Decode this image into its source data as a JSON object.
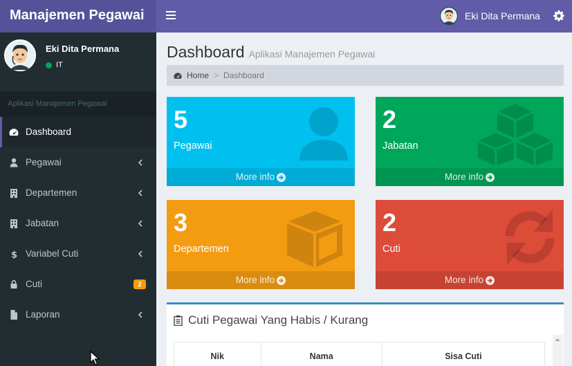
{
  "app": {
    "logo": "Manajemen Pegawai"
  },
  "user": {
    "name": "Eki Dita Permana",
    "status": "IT"
  },
  "sidebar": {
    "header": "Aplikasi Manajemen Pegawai",
    "items": [
      {
        "label": "Dashboard",
        "icon": "dashboard-icon"
      },
      {
        "label": "Pegawai",
        "icon": "user-icon"
      },
      {
        "label": "Departemen",
        "icon": "building-icon"
      },
      {
        "label": "Jabatan",
        "icon": "building-icon"
      },
      {
        "label": "Variabel Cuti",
        "icon": "dollar-icon"
      },
      {
        "label": "Cuti",
        "icon": "lock-icon",
        "badge": "2"
      },
      {
        "label": "Laporan",
        "icon": "file-icon"
      }
    ]
  },
  "page": {
    "title": "Dashboard",
    "subtitle": "Aplikasi Manajemen Pegawai"
  },
  "breadcrumb": {
    "home": "Home",
    "current": "Dashboard"
  },
  "boxes": [
    {
      "count": "5",
      "label": "Pegawai",
      "more": "More info",
      "color": "#00c0ef"
    },
    {
      "count": "2",
      "label": "Jabatan",
      "more": "More info",
      "color": "#00a65a"
    },
    {
      "count": "3",
      "label": "Departemen",
      "more": "More info",
      "color": "#f39c12"
    },
    {
      "count": "2",
      "label": "Cuti",
      "more": "More info",
      "color": "#dd4b39"
    }
  ],
  "panel": {
    "title": "Cuti Pegawai Yang Habis / Kurang",
    "columns": [
      "Nik",
      "Nama",
      "Sisa Cuti"
    ]
  },
  "colors": {
    "navbar": "#605ca8",
    "logo": "#555299",
    "sidebar": "#222d32"
  }
}
